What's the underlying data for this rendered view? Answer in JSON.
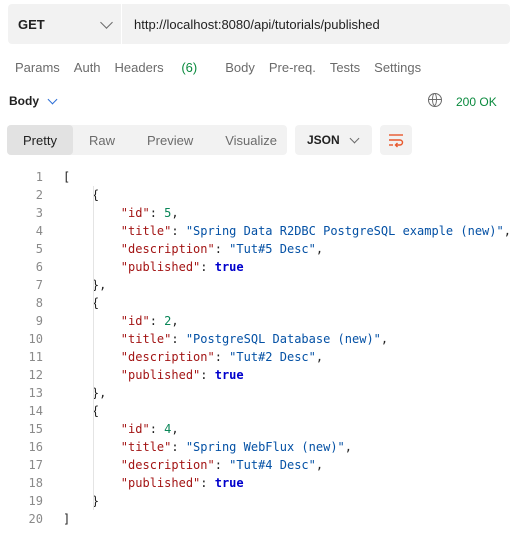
{
  "request": {
    "method": "GET",
    "url": "http://localhost:8080/api/tutorials/published"
  },
  "request_tabs": [
    {
      "label": "Params"
    },
    {
      "label": "Auth"
    },
    {
      "label": "Headers",
      "count": "(6)"
    },
    {
      "label": "Body"
    },
    {
      "label": "Pre-req."
    },
    {
      "label": "Tests"
    },
    {
      "label": "Settings"
    }
  ],
  "response": {
    "section_label": "Body",
    "status": "200 OK",
    "view_tabs": [
      "Pretty",
      "Raw",
      "Preview",
      "Visualize"
    ],
    "active_view": "Pretty",
    "format": "JSON"
  },
  "json_lines": [
    {
      "n": "1",
      "text": "["
    },
    {
      "n": "2",
      "text": "    {"
    },
    {
      "n": "3",
      "text": "        \"id\": 5,"
    },
    {
      "n": "4",
      "text": "        \"title\": \"Spring Data R2DBC PostgreSQL example (new)\","
    },
    {
      "n": "5",
      "text": "        \"description\": \"Tut#5 Desc\","
    },
    {
      "n": "6",
      "text": "        \"published\": true"
    },
    {
      "n": "7",
      "text": "    },"
    },
    {
      "n": "8",
      "text": "    {"
    },
    {
      "n": "9",
      "text": "        \"id\": 2,"
    },
    {
      "n": "10",
      "text": "        \"title\": \"PostgreSQL Database (new)\","
    },
    {
      "n": "11",
      "text": "        \"description\": \"Tut#2 Desc\","
    },
    {
      "n": "12",
      "text": "        \"published\": true"
    },
    {
      "n": "13",
      "text": "    },"
    },
    {
      "n": "14",
      "text": "    {"
    },
    {
      "n": "15",
      "text": "        \"id\": 4,"
    },
    {
      "n": "16",
      "text": "        \"title\": \"Spring WebFlux (new)\","
    },
    {
      "n": "17",
      "text": "        \"description\": \"Tut#4 Desc\","
    },
    {
      "n": "18",
      "text": "        \"published\": true"
    },
    {
      "n": "19",
      "text": "    }"
    },
    {
      "n": "20",
      "text": "]"
    }
  ],
  "colors": {
    "status_ok": "#0a8a3e",
    "key": "#a31515",
    "string": "#0451a5",
    "number": "#098658",
    "boolean": "#0000cc",
    "wrap_icon": "#e8582c"
  },
  "icons": {
    "globe": "globe-icon",
    "wrap": "wrap-lines-icon",
    "dropdown": "chevron-down-icon"
  }
}
